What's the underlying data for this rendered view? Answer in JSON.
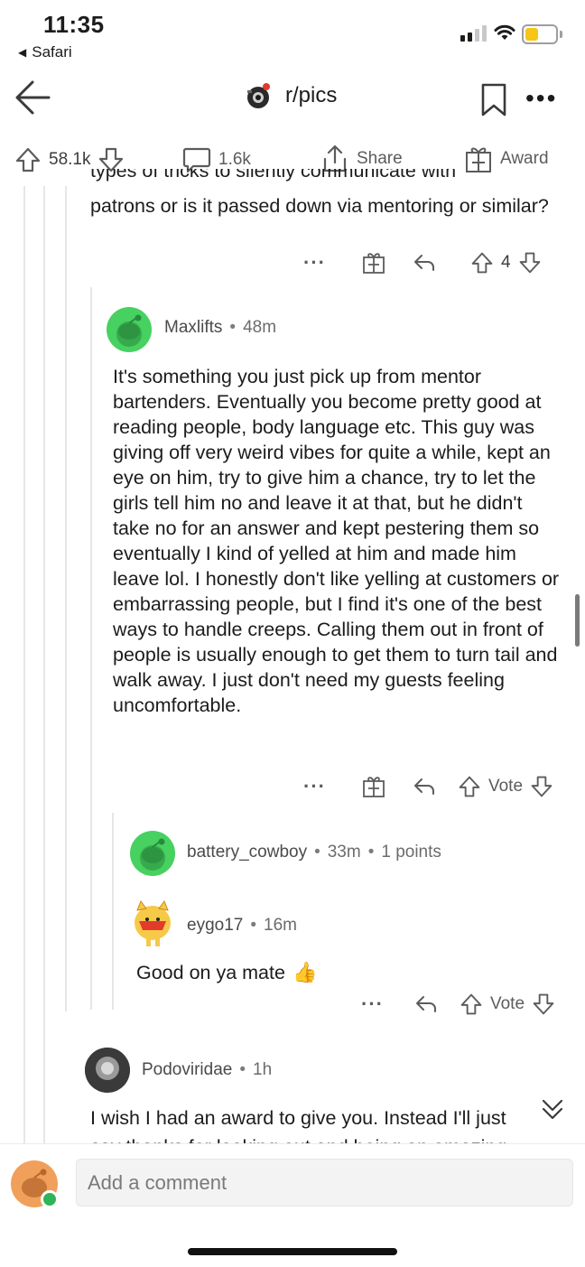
{
  "status_bar": {
    "time": "11:35",
    "back_app": "Safari",
    "battery_color": "#f5c518"
  },
  "header": {
    "title": "r/pics",
    "back_icon": "arrow-left-icon",
    "bookmark_icon": "bookmark-icon",
    "more_icon": "ellipsis-icon"
  },
  "post_actions": {
    "upvotes": "58.1k",
    "comments": "1.6k",
    "share": "Share",
    "award": "Award"
  },
  "parent_comment": {
    "clipped_line": "types of tricks to silently communicate with",
    "text": "patrons or is it passed down via mentoring or similar?",
    "score": "4"
  },
  "comments": [
    {
      "user": "Maxlifts",
      "age": "48m",
      "text": "It's something you just pick up from mentor bartenders. Eventually you become pretty good at reading people, body language etc. This guy was giving off very weird vibes for quite a while, kept an eye on him, try to give him a chance, try to let the girls tell him no and leave it at that, but he didn't take no for an answer and kept pestering them so eventually I kind of yelled at him and made him leave lol. I honestly don't like yelling at customers or embarrassing people, but I find it's one of the best ways to handle creeps. Calling them out in front of people is usually enough to get them to turn tail and walk away. I just don't need my guests feeling uncomfortable.",
      "vote_label": "Vote"
    },
    {
      "user": "battery_cowboy",
      "age": "33m",
      "points": "1 points"
    },
    {
      "user": "eygo17",
      "age": "16m",
      "text": "Good on ya mate",
      "emoji": "👍",
      "vote_label": "Vote"
    },
    {
      "user": "Podoviridae",
      "age": "1h",
      "text": "I wish I had an award to give you. Instead I'll just",
      "clipped_line": "say thanks for looking out and being an amazing"
    }
  ],
  "composer": {
    "placeholder": "Add a comment"
  },
  "colors": {
    "avatar_green": "#46d160",
    "online_dot": "#2fb457",
    "user_avatar_orange": "#f0a05a"
  }
}
